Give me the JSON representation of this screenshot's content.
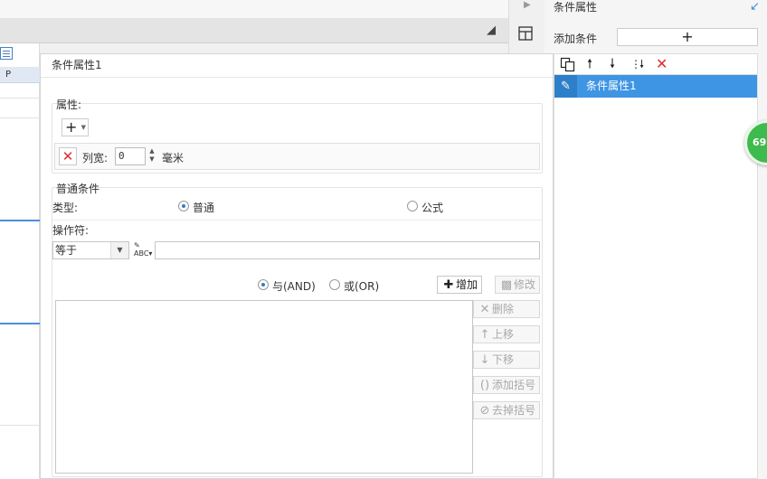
{
  "background": {
    "sheet_column_header": "P"
  },
  "right_panel": {
    "title": "条件属性",
    "add_condition_label": "添加条件",
    "add_condition_button": "+",
    "toolbar_icons": [
      "copy-icon",
      "move-up-icon",
      "move-down-icon",
      "sort-icon",
      "delete-icon"
    ],
    "items": [
      {
        "label": "条件属性1",
        "icon": "edit-icon",
        "selected": true
      }
    ],
    "badge_text": "69",
    "selected_color": "#3e95e3"
  },
  "dialog": {
    "title": "条件属性1",
    "attributes": {
      "label": "属性:",
      "add_button": "+",
      "col_width_label": "列宽:",
      "col_width_value": "0",
      "unit": "毫米"
    },
    "general": {
      "label": "普通条件",
      "type_label": "类型:",
      "type_options": [
        {
          "label": "普通",
          "selected": true
        },
        {
          "label": "公式",
          "selected": false
        }
      ],
      "operator_label": "操作符:",
      "operator_value": "等于",
      "value_input": "",
      "logic_options": [
        {
          "label": "与(AND)",
          "selected": true
        },
        {
          "label": "或(OR)",
          "selected": false
        }
      ],
      "buttons": {
        "add": "增加",
        "modify": "修改",
        "delete": "删除",
        "move_up": "上移",
        "move_down": "下移",
        "add_bracket": "添加括号",
        "remove_bracket": "去掉括号"
      }
    }
  }
}
